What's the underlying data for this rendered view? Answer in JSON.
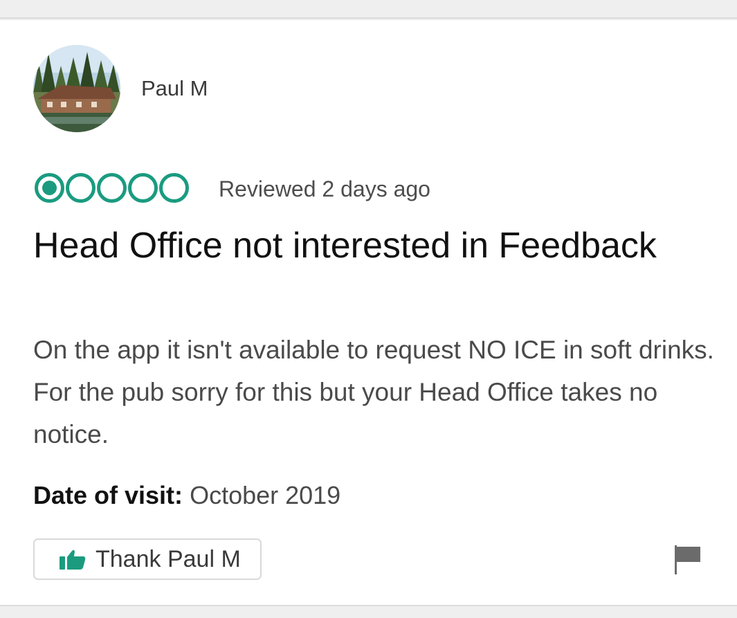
{
  "reviewer": {
    "name": "Paul M",
    "avatar_icon": "profile-photo-cabin"
  },
  "rating": {
    "score": 1,
    "max": 5,
    "color": "#1a9b7f"
  },
  "review": {
    "date_text": "Reviewed 2 days ago",
    "title": "Head Office not interested in Feedback",
    "body": "On the app it isn't available to request NO ICE in soft drinks. For the pub sorry for this but your Head Office takes no notice.",
    "visit_label": "Date of visit:",
    "visit_value": "October 2019"
  },
  "actions": {
    "thank_label": "Thank Paul M",
    "thank_icon": "thumbs-up-icon",
    "flag_icon": "flag-icon"
  }
}
